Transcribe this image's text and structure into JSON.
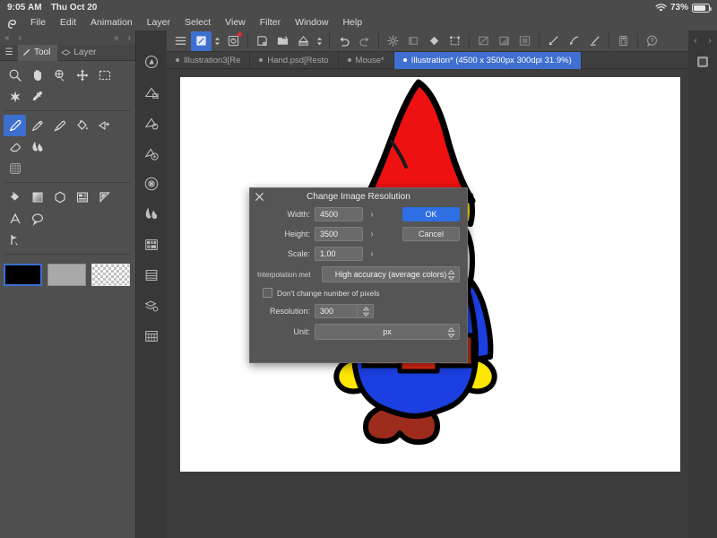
{
  "statusbar": {
    "time": "9:05 AM",
    "date": "Thu Oct 20",
    "wifi_icon": "wifi-icon",
    "battery_percent": "73%",
    "battery_icon": "battery-icon"
  },
  "menubar": {
    "logo_icon": "app-logo-icon",
    "items": [
      {
        "label": "File"
      },
      {
        "label": "Edit"
      },
      {
        "label": "Animation"
      },
      {
        "label": "Layer"
      },
      {
        "label": "Select"
      },
      {
        "label": "View"
      },
      {
        "label": "Filter"
      },
      {
        "label": "Window"
      },
      {
        "label": "Help"
      }
    ]
  },
  "left_panel": {
    "nav": {
      "prev_all": "«",
      "prev": "‹",
      "collapse": "«",
      "next": "›"
    },
    "hamburger_icon": "menu-icon",
    "tabs": [
      {
        "label": "Tool",
        "icon": "brush-icon",
        "active": true
      },
      {
        "label": "Layer",
        "icon": "layer-icon",
        "active": false
      }
    ],
    "tools_row1": [
      {
        "name": "zoom-tool",
        "icon": "magnifier-icon"
      },
      {
        "name": "hand-tool",
        "icon": "hand-icon"
      },
      {
        "name": "object-select-tool",
        "icon": "object-select-icon"
      },
      {
        "name": "move-tool",
        "icon": "move-arrows-icon"
      },
      {
        "name": "marquee-select-tool",
        "icon": "dashed-rectangle-icon"
      },
      {
        "name": "auto-select-tool",
        "icon": "magic-wand-icon"
      },
      {
        "name": "eyedropper-tool",
        "icon": "eyedropper-icon"
      }
    ],
    "tools_row2": [
      {
        "name": "pen-tool",
        "icon": "pen-icon",
        "selected": true
      },
      {
        "name": "pencil-tool",
        "icon": "pencil-icon"
      },
      {
        "name": "brush-tool",
        "icon": "brush-nib-icon"
      },
      {
        "name": "fill-tool",
        "icon": "paint-bucket-icon"
      },
      {
        "name": "airbrush-tool",
        "icon": "airbrush-plus-icon"
      },
      {
        "name": "eraser-tool",
        "icon": "eraser-icon"
      },
      {
        "name": "blend-tool",
        "icon": "blend-drop-icon"
      }
    ],
    "tools_row3": [
      {
        "name": "gradient-tool",
        "icon": "gradient-grid-icon"
      }
    ],
    "tools_row4": [
      {
        "name": "shape-fill-tool",
        "icon": "diamond-fill-icon"
      },
      {
        "name": "gradient-square-tool",
        "icon": "gradient-square-icon"
      },
      {
        "name": "polygon-tool",
        "icon": "hexagon-icon"
      },
      {
        "name": "frame-tool",
        "icon": "frame-layout-icon"
      },
      {
        "name": "ruler-tool",
        "icon": "triangle-ruler-icon"
      },
      {
        "name": "text-tool",
        "icon": "text-a-icon"
      },
      {
        "name": "balloon-tool",
        "icon": "speech-balloon-icon"
      }
    ],
    "tools_row5": [
      {
        "name": "operation-tool",
        "icon": "arrow-cursor-icon"
      }
    ],
    "swatches": [
      {
        "name": "main-color-swatch",
        "color": "#000000",
        "selected": true
      },
      {
        "name": "sub-color-swatch",
        "color": "#a9a9a9",
        "selected": false
      },
      {
        "name": "transparent-swatch",
        "color": "transparent",
        "selected": false
      }
    ]
  },
  "icon_rail": [
    {
      "name": "navigator-panel",
      "icon": "navigator-icon"
    },
    {
      "name": "brush-size-panel",
      "icon": "brush-size-icon"
    },
    {
      "name": "sub-tool-detail-panel",
      "icon": "brush-gear-icon"
    },
    {
      "name": "tool-property-panel",
      "icon": "brush-property-icon"
    },
    {
      "name": "color-circle-panel",
      "icon": "color-circle-icon"
    },
    {
      "name": "color-blend-panel",
      "icon": "color-blend-icon"
    },
    {
      "name": "color-set-panel",
      "icon": "color-set-icon"
    },
    {
      "name": "material-panel",
      "icon": "material-list-icon"
    },
    {
      "name": "layer-property-panel",
      "icon": "layer-stack-icon"
    },
    {
      "name": "timeline-panel",
      "icon": "timeline-grid-icon"
    }
  ],
  "toolbar": {
    "groups": [
      [
        {
          "name": "menu-button",
          "icon": "hamburger-icon"
        },
        {
          "name": "new-document-button",
          "icon": "new-doc-icon",
          "active": true
        },
        {
          "name": "new-document-dropdown",
          "icon": "chevron-updown-icon",
          "small": true
        },
        {
          "name": "record-button",
          "icon": "spiral-record-icon",
          "badge": true
        }
      ],
      [
        {
          "name": "save-button",
          "icon": "save-disk-icon"
        },
        {
          "name": "open-button",
          "icon": "open-folder-icon"
        },
        {
          "name": "export-button",
          "icon": "export-icon"
        },
        {
          "name": "export-dropdown",
          "icon": "chevron-updown-icon",
          "small": true
        }
      ],
      [
        {
          "name": "undo-button",
          "icon": "undo-arrow-icon"
        },
        {
          "name": "redo-button",
          "icon": "redo-arrow-icon"
        }
      ],
      [
        {
          "name": "clear-button",
          "icon": "sparkle-clear-icon"
        },
        {
          "name": "fill-button",
          "icon": "fill-square-icon"
        },
        {
          "name": "fill-color-button",
          "icon": "fill-diamond-icon"
        },
        {
          "name": "scale-rotate-button",
          "icon": "scale-rotate-icon"
        }
      ],
      [
        {
          "name": "select-all-button",
          "icon": "select-all-icon"
        },
        {
          "name": "deselect-button",
          "icon": "deselect-icon"
        },
        {
          "name": "invert-selection-button",
          "icon": "invert-select-icon"
        }
      ],
      [
        {
          "name": "vector-point-button",
          "icon": "vector-point-icon"
        },
        {
          "name": "vector-curve-button",
          "icon": "vector-curve-icon"
        },
        {
          "name": "vector-line-button",
          "icon": "vector-line-icon"
        }
      ],
      [
        {
          "name": "quick-access-button",
          "icon": "quick-access-icon"
        }
      ],
      [
        {
          "name": "help-button",
          "icon": "help-balloon-icon"
        }
      ]
    ],
    "collapse_icon": "chevron-left-icon"
  },
  "document_tabs": {
    "items": [
      {
        "label": "Illustration3[Re",
        "active": false
      },
      {
        "label": "Hand.psd[Resto",
        "active": false
      },
      {
        "label": "Mouse*",
        "active": false
      },
      {
        "label": "Illustration* (4500 x 3500px 300dpi 31.9%)",
        "active": true
      }
    ],
    "dropdown_icon": "chevron-down-icon",
    "thumbnail_icon": "canvas-thumbnail-icon"
  },
  "right_rail": {
    "prev_icon": "chevron-left-icon",
    "next_icon": "chevron-right-icon",
    "panel_icon": "canvas-preview-icon"
  },
  "dialog": {
    "title": "Change Image Resolution",
    "close_icon": "close-icon",
    "fields": [
      {
        "label": "Width:",
        "value": "4500",
        "chevron": "›",
        "name": "width-field"
      },
      {
        "label": "Height:",
        "value": "3500",
        "chevron": "›",
        "name": "height-field"
      },
      {
        "label": "Scale:",
        "value": "1.00",
        "chevron": "›",
        "name": "scale-field"
      }
    ],
    "buttons": [
      {
        "label": "OK",
        "primary": true,
        "name": "ok-button"
      },
      {
        "label": "Cancel",
        "primary": false,
        "name": "cancel-button"
      }
    ],
    "interpolation": {
      "label": "Interpolation met",
      "value": "High accuracy (average colors)"
    },
    "checkbox": {
      "label": "Don't change number of pixels",
      "checked": false
    },
    "resolution": {
      "label": "Resolution:",
      "value": "300"
    },
    "unit": {
      "label": "Unit:",
      "value": "px"
    }
  },
  "artwork": {
    "name": "gnome-illustration",
    "colors": {
      "hat": "#ee1111",
      "hat_shadow": "#cc0d0d",
      "hair": "#ffe600",
      "beard": "#e9e9e9",
      "beard_shade": "#cfcfcf",
      "body": "#1b3fe0",
      "belt": "#a8301a",
      "buckle": "#e02a12",
      "hands": "#ffe600",
      "boots": "#9e2c1c",
      "outline": "#000000",
      "canvas_bg": "#ffffff"
    }
  }
}
